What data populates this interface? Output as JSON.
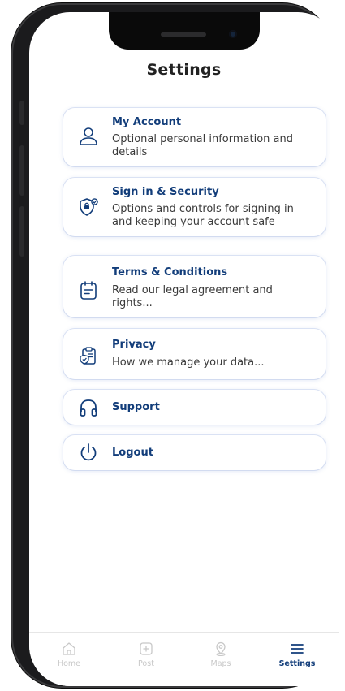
{
  "screen": {
    "title": "Settings"
  },
  "menu": [
    {
      "title": "My Account",
      "description": "Optional personal information and details",
      "icon": "user-icon"
    },
    {
      "title": "Sign in & Security",
      "description": "Options and controls for signing in and keeping your account safe",
      "icon": "shield-lock-icon"
    },
    {
      "title": "Terms & Conditions",
      "description": "Read our legal agreement and rights...",
      "icon": "document-icon"
    },
    {
      "title": "Privacy",
      "description": "How we manage your data...",
      "icon": "clipboard-check-icon"
    },
    {
      "title": "Support",
      "icon": "headphones-icon"
    },
    {
      "title": "Logout",
      "icon": "power-icon"
    }
  ],
  "tabbar": {
    "items": [
      {
        "label": "Home",
        "icon": "home-icon",
        "active": false
      },
      {
        "label": "Post",
        "icon": "add-square-icon",
        "active": false
      },
      {
        "label": "Maps",
        "icon": "map-pin-icon",
        "active": false
      },
      {
        "label": "Settings",
        "icon": "menu-icon",
        "active": true
      }
    ]
  },
  "colors": {
    "accent": "#123d7a",
    "inactive": "#c8c8c8",
    "text": "#3a3a3a"
  }
}
